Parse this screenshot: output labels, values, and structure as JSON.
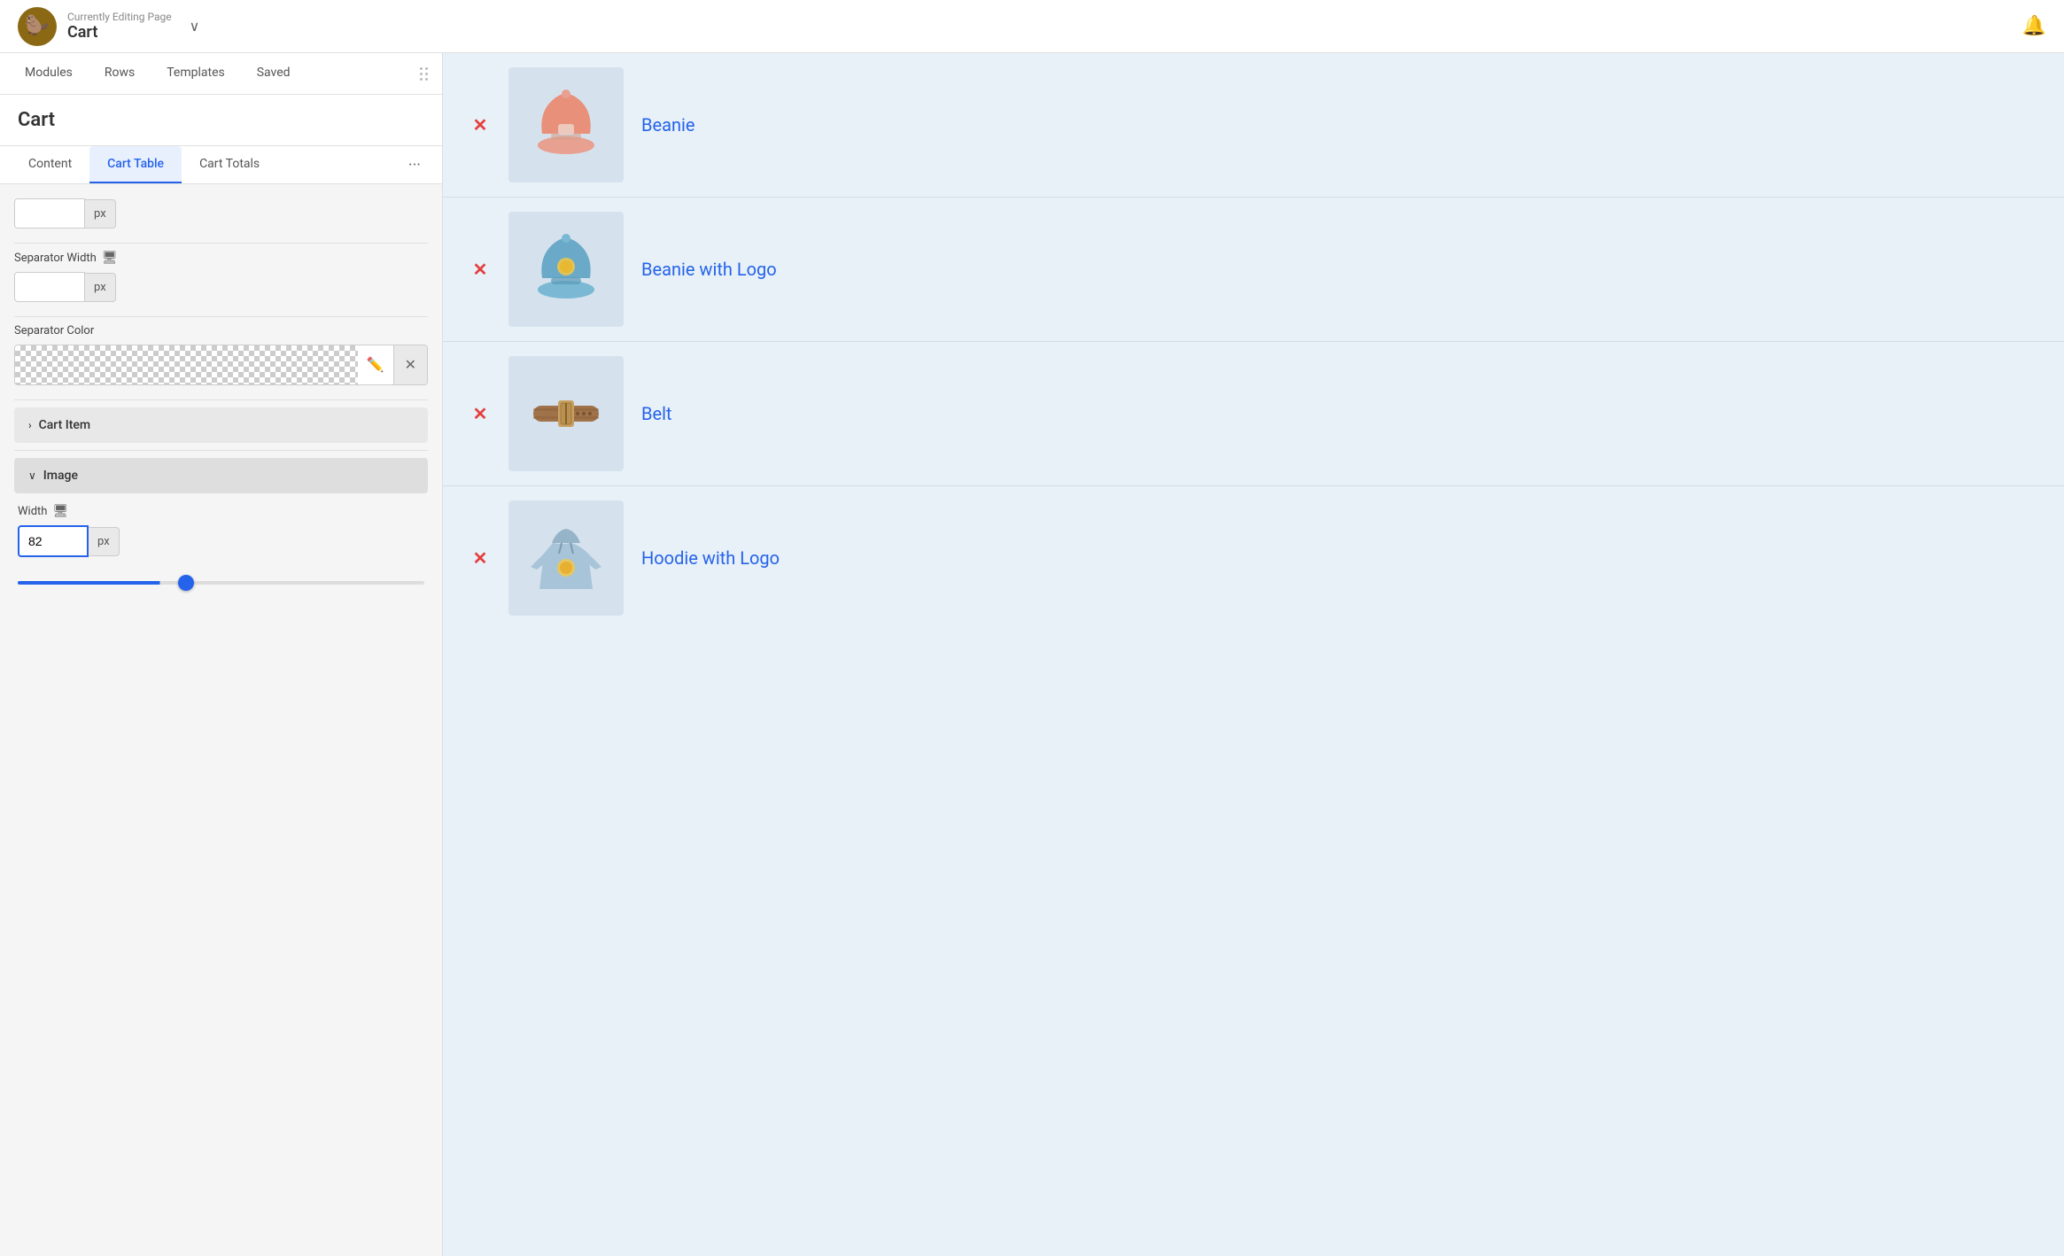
{
  "header": {
    "editing_label": "Currently Editing Page",
    "page_name": "Cart",
    "logo_emoji": "🦫",
    "bell_icon": "🔔",
    "chevron": "∨"
  },
  "left_panel": {
    "tabs": [
      {
        "id": "modules",
        "label": "Modules",
        "active": false
      },
      {
        "id": "rows",
        "label": "Rows",
        "active": false
      },
      {
        "id": "templates",
        "label": "Templates",
        "active": false
      },
      {
        "id": "saved",
        "label": "Saved",
        "active": false
      }
    ],
    "cart_title": "Cart",
    "sub_tabs": [
      {
        "id": "content",
        "label": "Content",
        "active": false
      },
      {
        "id": "cart-table",
        "label": "Cart Table",
        "active": true
      },
      {
        "id": "cart-totals",
        "label": "Cart Totals",
        "active": false
      }
    ],
    "sub_tab_more": "···",
    "separator_width_label": "Separator Width",
    "separator_color_label": "Separator Color",
    "px_unit": "px",
    "separator_width_value": "",
    "cart_item_section": "Cart Item",
    "image_section": "Image",
    "width_label": "Width",
    "width_value": "82",
    "slider_percent": 35
  },
  "cart_items": [
    {
      "id": "beanie",
      "name": "Beanie",
      "image_type": "beanie_pink"
    },
    {
      "id": "beanie-logo",
      "name": "Beanie with Logo",
      "image_type": "beanie_blue"
    },
    {
      "id": "belt",
      "name": "Belt",
      "image_type": "belt"
    },
    {
      "id": "hoodie-logo",
      "name": "Hoodie with Logo",
      "image_type": "hoodie"
    }
  ],
  "colors": {
    "accent_blue": "#2563eb",
    "remove_red": "#e53e3e",
    "cart_bg": "#e8f1f8",
    "item_image_bg": "#d5e2ed"
  }
}
